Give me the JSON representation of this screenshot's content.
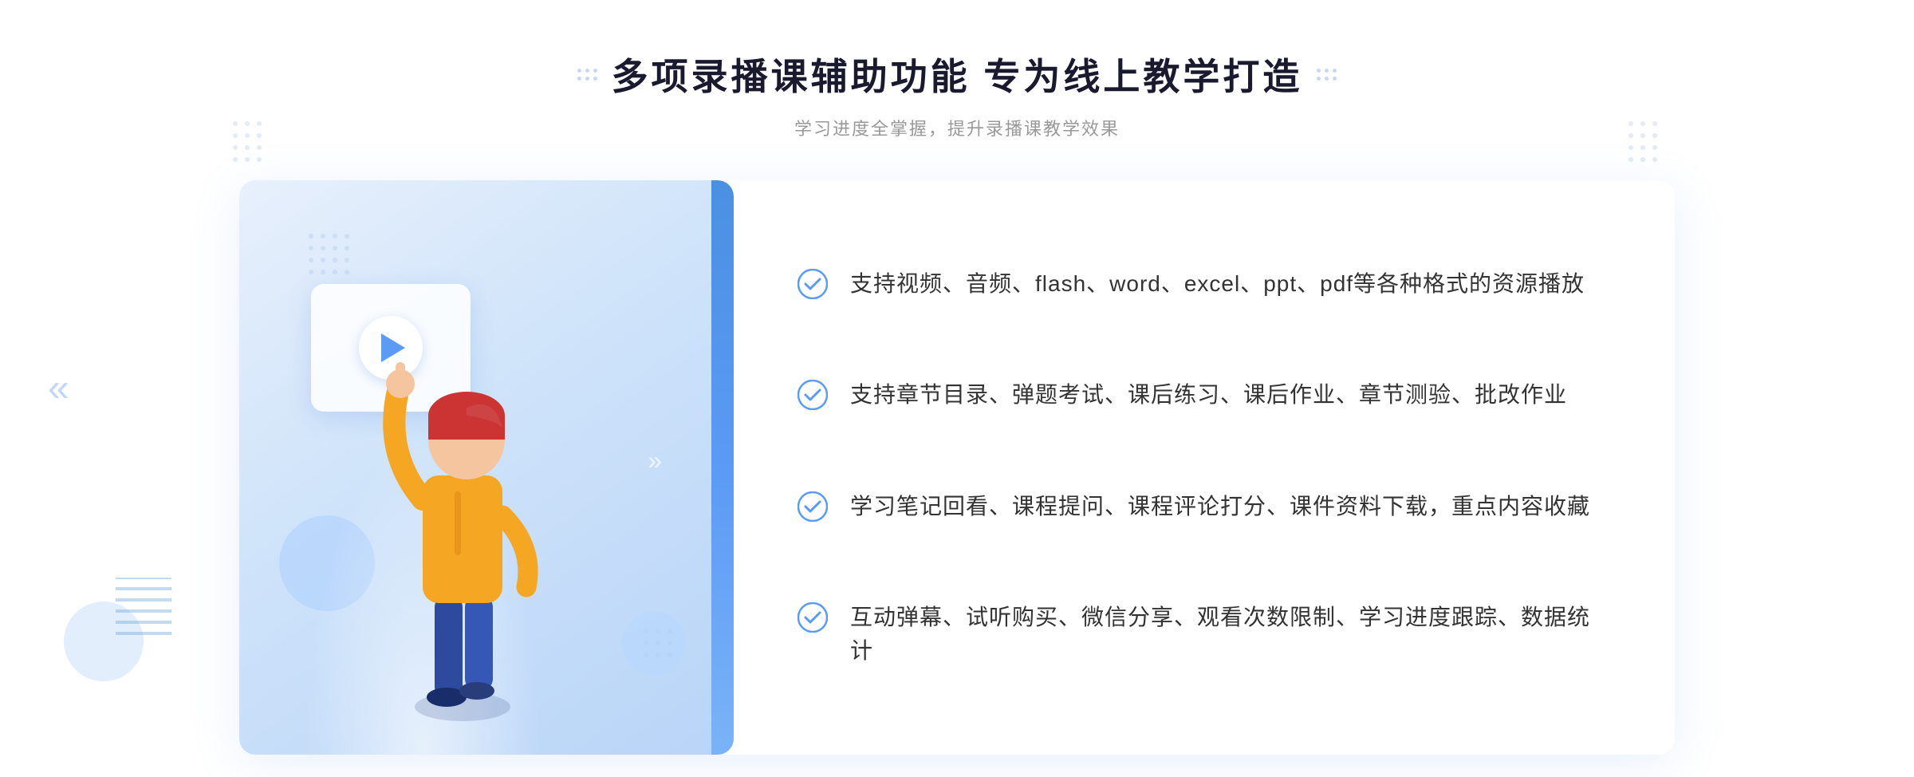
{
  "page": {
    "title": "多项录播课辅助功能 专为线上教学打造",
    "subtitle": "学习进度全掌握，提升录播课教学效果",
    "features": [
      {
        "id": "feature-1",
        "text": "支持视频、音频、flash、word、excel、ppt、pdf等各种格式的资源播放"
      },
      {
        "id": "feature-2",
        "text": "支持章节目录、弹题考试、课后练习、课后作业、章节测验、批改作业"
      },
      {
        "id": "feature-3",
        "text": "学习笔记回看、课程提问、课程评论打分、课件资料下载，重点内容收藏"
      },
      {
        "id": "feature-4",
        "text": "互动弹幕、试听购买、微信分享、观看次数限制、学习进度跟踪、数据统计"
      }
    ]
  },
  "colors": {
    "primary": "#4a90e2",
    "title": "#1a1a2e",
    "subtitle": "#999999",
    "text": "#333333",
    "check": "#5b9af5"
  }
}
